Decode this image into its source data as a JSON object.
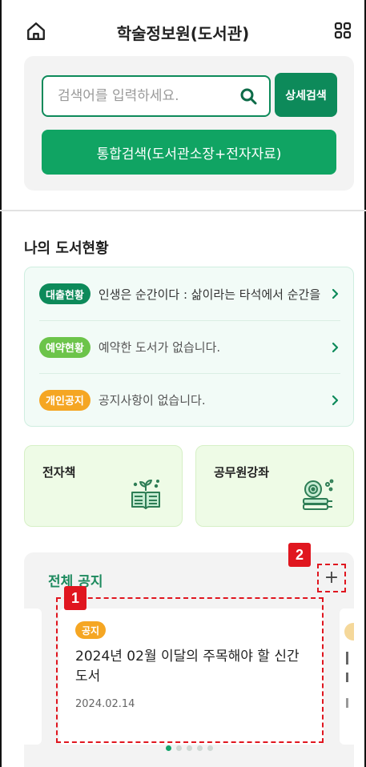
{
  "header": {
    "title": "학술정보원(도서관)",
    "home_icon": "home-icon",
    "menu_icon": "grid-menu-icon"
  },
  "search": {
    "placeholder": "검색어를 입력하세요.",
    "value": "",
    "detail_button": "상세검색",
    "integrated_button": "통합검색(도서관소장+전자자료)"
  },
  "my_status": {
    "title": "나의 도서현황",
    "rows": [
      {
        "badge": "대출현황",
        "badge_color": "#0d8a5a",
        "text": "인생은 순간이다 : 삶이라는 타석에서 순간을",
        "muted": false
      },
      {
        "badge": "예약현황",
        "badge_color": "#6cc44a",
        "text": "예약한 도서가 없습니다.",
        "muted": true
      },
      {
        "badge": "개인공지",
        "badge_color": "#f5a623",
        "text": "공지사항이 없습니다.",
        "muted": true
      }
    ]
  },
  "tiles": [
    {
      "label": "전자책",
      "icon": "ebook-icon"
    },
    {
      "label": "공무원강좌",
      "icon": "lecture-icon"
    }
  ],
  "notices": {
    "title": "전체 공지",
    "more_label": "+",
    "marker_1": "1",
    "marker_2": "2",
    "card": {
      "badge": "공지",
      "title": "2024년 02월 이달의 주목해야 할 신간 도서",
      "date": "2024.02.14"
    },
    "page_count": 5,
    "active_page": 1
  },
  "colors": {
    "primary": "#0d8a5a",
    "primary_light": "#10a463",
    "highlight": "#e0161f",
    "notice_badge": "#f5a623"
  }
}
